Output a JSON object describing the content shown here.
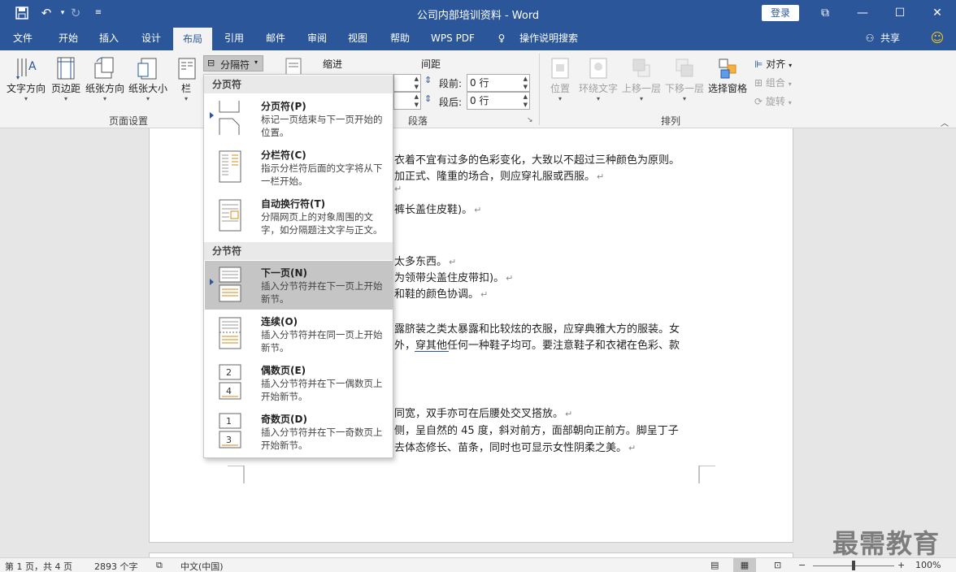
{
  "titlebar": {
    "title": "公司内部培训资料  -  Word",
    "login": "登录",
    "undo_icon": "undo-icon",
    "redo_icon": "redo-icon"
  },
  "tabs": [
    "文件",
    "开始",
    "插入",
    "设计",
    "布局",
    "引用",
    "邮件",
    "审阅",
    "视图",
    "帮助",
    "WPS PDF",
    "操作说明搜索"
  ],
  "active_tab": "布局",
  "share": "共享",
  "ribbon": {
    "page_setup": {
      "label": "页面设置",
      "buttons": [
        "文字方向",
        "页边距",
        "纸张方向",
        "纸张大小",
        "栏"
      ],
      "breaks_button": "分隔符"
    },
    "paragraph": {
      "label": "段落",
      "indent_label": "缩进",
      "spacing_label": "间距",
      "before_label": "段前:",
      "before_value": "0 行",
      "after_label": "段后:",
      "after_value": "0 行"
    },
    "arrange": {
      "label": "排列",
      "buttons": [
        "位置",
        "环绕文字",
        "上移一层",
        "下移一层",
        "选择窗格"
      ],
      "align": "对齐",
      "group": "组合",
      "rotate": "旋转"
    }
  },
  "menu": {
    "page_breaks_header": "分页符",
    "section_breaks_header": "分节符",
    "items": [
      {
        "title": "分页符(P)",
        "desc": "标记一页结束与下一页开始的位置。"
      },
      {
        "title": "分栏符(C)",
        "desc": "指示分栏符后面的文字将从下一栏开始。"
      },
      {
        "title": "自动换行符(T)",
        "desc": "分隔网页上的对象周围的文字，如分隔题注文字与正文。"
      },
      {
        "title": "下一页(N)",
        "desc": "插入分节符并在下一页上开始新节。"
      },
      {
        "title": "连续(O)",
        "desc": "插入分节符并在同一页上开始新节。"
      },
      {
        "title": "偶数页(E)",
        "desc": "插入分节符并在下一偶数页上开始新节。"
      },
      {
        "title": "奇数页(D)",
        "desc": "插入分节符并在下一奇数页上开始新节。"
      }
    ]
  },
  "document": {
    "lines": [
      "衣着不宜有过多的色彩变化，大致以不超过三种颜色为原则。",
      "加正式、隆重的场合，则应穿礼服或西服。",
      "裤长盖住皮鞋)。",
      "太多东西。",
      "为领带尖盖住皮带扣)。",
      "和鞋的颜色协调。",
      "露脐装之类太暴露和比较炫的衣服，应穿典雅大方的服装。女",
      "外，穿其他任何一种鞋子均可。要注意鞋子和衣裙在色彩、款",
      "同宽，双手亦可在后腰处交叉搭放。",
      "侧，呈自然的 45 度，斜对前方，面部朝向正前方。脚呈丁子",
      "去体态修长、苗条，同时也可显示女性阴柔之美。"
    ]
  },
  "statusbar": {
    "page": "第 1 页，共 4 页",
    "words": "2893 个字",
    "language": "中文(中国)",
    "zoom_minus": "−",
    "zoom_plus": "+",
    "zoom": "100%"
  },
  "watermark": "最需教育"
}
